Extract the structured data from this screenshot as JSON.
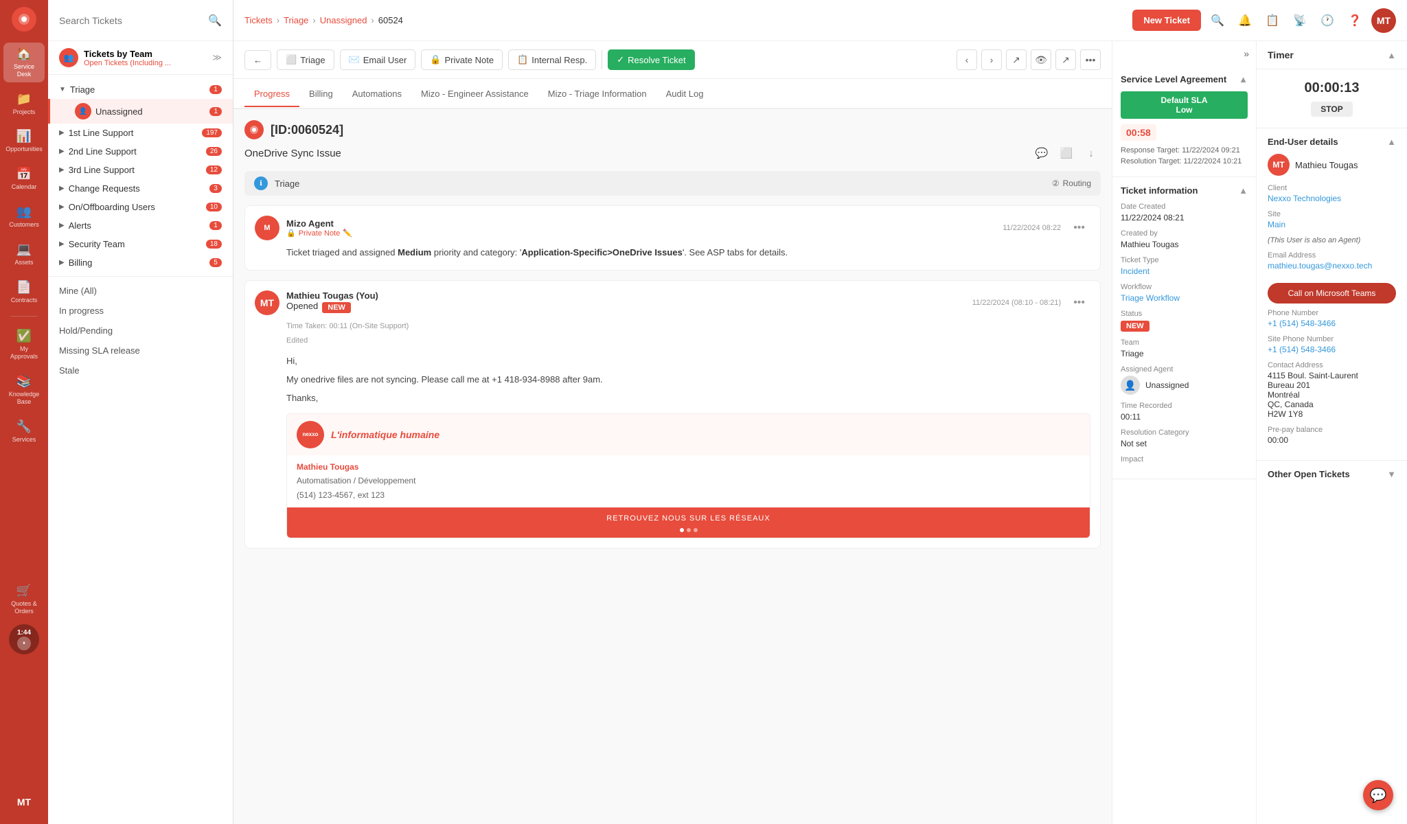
{
  "app": {
    "logo": "●",
    "logo_label": "SD"
  },
  "sidebar": {
    "items": [
      {
        "id": "service-desk",
        "icon": "🏠",
        "label": "Service Desk",
        "active": true
      },
      {
        "id": "projects",
        "icon": "📁",
        "label": "Projects"
      },
      {
        "id": "opportunities",
        "icon": "📊",
        "label": "Opportunities"
      },
      {
        "id": "calendar",
        "icon": "📅",
        "label": "Calendar"
      },
      {
        "id": "customers",
        "icon": "👥",
        "label": "Customers"
      },
      {
        "id": "assets",
        "icon": "💻",
        "label": "Assets"
      },
      {
        "id": "contracts",
        "icon": "📄",
        "label": "Contracts"
      },
      {
        "id": "approvals",
        "icon": "✅",
        "label": "My Approvals"
      },
      {
        "id": "knowledge",
        "icon": "📚",
        "label": "Knowledge Base"
      },
      {
        "id": "services",
        "icon": "🔧",
        "label": "Services"
      },
      {
        "id": "quotes",
        "icon": "🛒",
        "label": "Quotes & Orders"
      }
    ],
    "timer": {
      "value": "1:44"
    },
    "avatar": "MT"
  },
  "nav": {
    "search_placeholder": "Search Tickets",
    "team_label": "Tickets by Team",
    "team_subtitle": "Open Tickets (Including ...",
    "tree": [
      {
        "id": "triage",
        "label": "Triage",
        "expanded": true,
        "badge": "1",
        "children": [
          {
            "id": "unassigned",
            "label": "Unassigned",
            "badge": "1",
            "active": true
          }
        ]
      },
      {
        "id": "1st-line",
        "label": "1st Line Support",
        "badge": "197"
      },
      {
        "id": "2nd-line",
        "label": "2nd Line Support",
        "badge": "26"
      },
      {
        "id": "3rd-line",
        "label": "3rd Line Support",
        "badge": "12"
      },
      {
        "id": "change-req",
        "label": "Change Requests",
        "badge": "3"
      },
      {
        "id": "on-offboard",
        "label": "On/Offboarding Users",
        "badge": "10"
      },
      {
        "id": "alerts",
        "label": "Alerts",
        "badge": "1"
      },
      {
        "id": "security",
        "label": "Security Team",
        "badge": "18"
      },
      {
        "id": "billing",
        "label": "Billing",
        "badge": "5"
      }
    ],
    "flat_items": [
      {
        "id": "mine",
        "label": "Mine (All)"
      },
      {
        "id": "in-progress",
        "label": "In progress"
      },
      {
        "id": "hold",
        "label": "Hold/Pending"
      },
      {
        "id": "missing-sla",
        "label": "Missing SLA release"
      },
      {
        "id": "stale",
        "label": "Stale"
      }
    ]
  },
  "topbar": {
    "breadcrumb": [
      "Tickets",
      "Triage",
      "Unassigned",
      "60524"
    ],
    "new_ticket_label": "New Ticket"
  },
  "toolbar": {
    "back_label": "←",
    "triage_label": "Triage",
    "email_user_label": "Email User",
    "private_note_label": "Private Note",
    "internal_resp_label": "Internal Resp.",
    "resolve_ticket_label": "Resolve Ticket"
  },
  "tabs": [
    {
      "id": "progress",
      "label": "Progress",
      "active": true
    },
    {
      "id": "billing",
      "label": "Billing"
    },
    {
      "id": "automations",
      "label": "Automations"
    },
    {
      "id": "mizo-engineer",
      "label": "Mizo - Engineer Assistance"
    },
    {
      "id": "mizo-triage",
      "label": "Mizo - Triage Information"
    },
    {
      "id": "audit",
      "label": "Audit Log"
    }
  ],
  "ticket": {
    "id": "[ID:0060524]",
    "subject": "OneDrive Sync Issue",
    "triage_label": "Triage",
    "routing_label": "Routing",
    "routing_icon": "⊘"
  },
  "messages": [
    {
      "id": "mizo-msg",
      "avatar": "M",
      "name": "Mizo Agent",
      "time": "11/22/2024 08:22",
      "tag": "Private Note",
      "tag_icon": "🔒",
      "body": "Ticket triaged and assigned Medium priority and category: 'Application-Specific>OneDrive Issues'. See ASP tabs for details.",
      "body_bold_word": "Medium"
    },
    {
      "id": "mathieu-msg",
      "avatar": "MT",
      "name": "Mathieu Tougas (You)",
      "time": "11/22/2024 (08:10 - 08:21)",
      "status": "Opened",
      "badge": "NEW",
      "time_taken": "Time Taken: 00:11 (On-Site Support)",
      "edited": "Edited",
      "greeting": "Hi,",
      "body_line1": "My onedrive files are not syncing. Please call me at +1 418-934-8988 after 9am.",
      "thanks": "Thanks,",
      "sig": {
        "company": "L'informatique humaine",
        "name": "Mathieu Tougas",
        "role": "Automatisation / Développement",
        "phone": "(514) 123-4567, ext 123",
        "banner": "RETROUVEZ NOUS SUR LES RÉSEAUX"
      }
    }
  ],
  "right_panel": {
    "sla": {
      "title": "Service Level Agreement",
      "badge_label": "Default SLA\nLow",
      "timer": "00:58",
      "response_target": "Response Target: 11/22/2024 09:21",
      "resolution_target": "Resolution Target: 11/22/2024 10:21"
    },
    "ticket_info": {
      "title": "Ticket information",
      "date_created_label": "Date Created",
      "date_created": "11/22/2024 08:21",
      "created_by_label": "Created by",
      "created_by": "Mathieu Tougas",
      "ticket_type_label": "Ticket Type",
      "ticket_type": "Incident",
      "workflow_label": "Workflow",
      "workflow": "Triage Workflow",
      "status_label": "Status",
      "status": "NEW",
      "team_label": "Team",
      "team": "Triage",
      "assigned_agent_label": "Assigned Agent",
      "assigned_agent": "Unassigned",
      "time_recorded_label": "Time Recorded",
      "time_recorded": "00:11",
      "resolution_cat_label": "Resolution Category",
      "resolution_cat": "Not set",
      "impact_label": "Impact"
    }
  },
  "timer_panel": {
    "title": "Timer",
    "value": "00:00:13",
    "stop_label": "STOP"
  },
  "end_user": {
    "title": "End-User details",
    "name": "Mathieu Tougas",
    "avatar": "MT"
  },
  "client_info": {
    "client_label": "Client",
    "client": "Nexxo Technologies",
    "site_label": "Site",
    "site": "Main",
    "agent_note": "(This User is also an Agent)",
    "email_label": "Email Address",
    "email": "mathieu.tougas@nexxo.tech",
    "call_teams_label": "Call on Microsoft Teams",
    "phone_label": "Phone Number",
    "phone": "+1 (514) 548-3466",
    "site_phone_label": "Site Phone Number",
    "site_phone": "+1 (514) 548-3466",
    "contact_address_label": "Contact Address",
    "address_line1": "4115 Boul. Saint-Laurent",
    "address_line2": "Bureau 201",
    "address_city": "Montréal",
    "address_province": "QC, Canada",
    "address_postal": "H2W 1Y8",
    "prepay_label": "Pre-pay balance",
    "prepay": "00:00",
    "other_tickets_label": "Other Open Tickets"
  },
  "chat_btn_icon": "💬"
}
